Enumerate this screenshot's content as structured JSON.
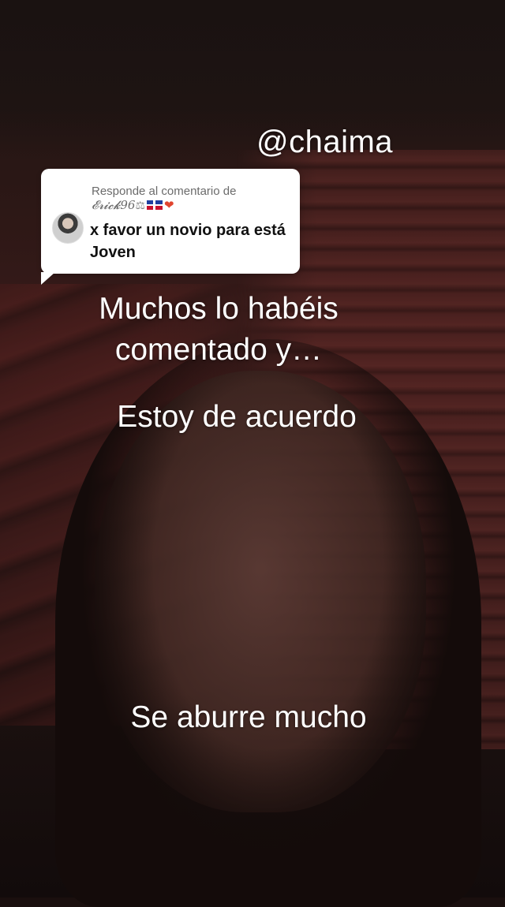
{
  "video": {
    "username_sticker": "@chaima"
  },
  "comment_reply": {
    "label": "Responde al comentario de",
    "username": "𝓔𝓻𝓲𝓬𝓴96",
    "username_emojis": [
      "scale-icon",
      "dominican-flag-icon",
      "heart-fire-icon"
    ],
    "text": "x favor un novio para está Joven"
  },
  "captions": {
    "line1": "Muchos lo habéis\ncomentado y…",
    "line2": "Estoy de acuerdo",
    "line3": "Se aburre mucho"
  }
}
